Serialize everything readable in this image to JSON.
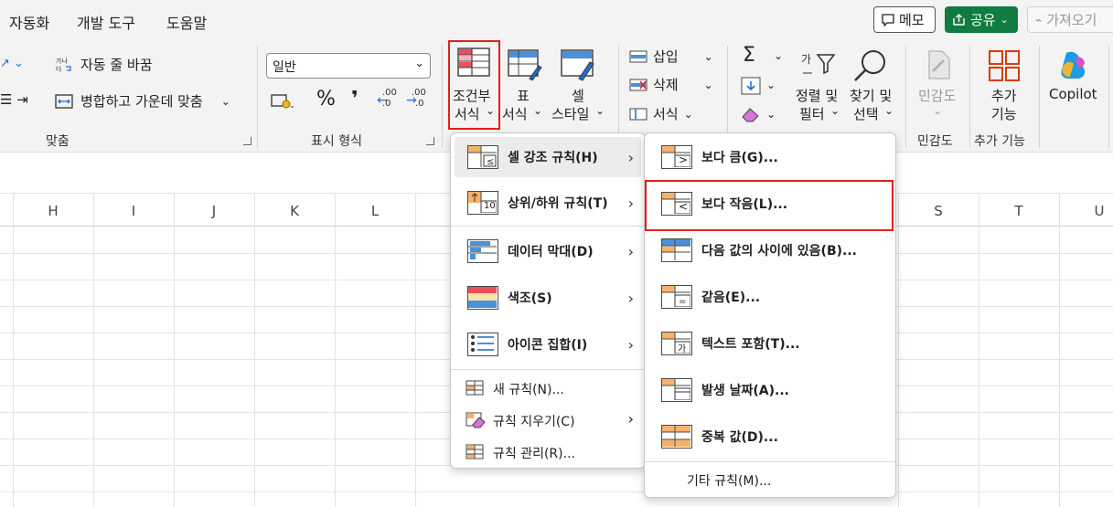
{
  "menubar": {
    "tabs": [
      "자동화",
      "개발 도구",
      "도움말"
    ],
    "memo_label": "메모",
    "share_label": "공유",
    "import_label": "가져오기"
  },
  "ribbon": {
    "alignment": {
      "wrap_text": "자동 줄 바꿈",
      "merge_center": "병합하고 가운데 맞춤",
      "group_label": "맞춤"
    },
    "number": {
      "format_value": "일반",
      "group_label": "표시 형식",
      "percent_symbol": "%",
      "comma_symbol": "❜",
      "inc_decimal": ".00",
      "dec_decimal": ".00"
    },
    "styles": {
      "conditional_line1": "조건부",
      "conditional_line2": "서식",
      "table_line1": "표",
      "table_line2": "서식",
      "cell_line1": "셀",
      "cell_line2": "스타일"
    },
    "cells": {
      "insert": "삽입",
      "delete": "삭제",
      "format": "서식"
    },
    "editing": {
      "sort_line1": "정렬 및",
      "sort_line2": "필터",
      "find_line1": "찾기 및",
      "find_line2": "선택"
    },
    "sensitivity": {
      "line1": "민감도",
      "group_label": "민감도"
    },
    "addins": {
      "line1": "추가",
      "line2": "기능",
      "group_label": "추가 기능"
    },
    "copilot": {
      "label": "Copilot"
    }
  },
  "sheet": {
    "columns": [
      "H",
      "I",
      "J",
      "K",
      "L",
      "S",
      "T",
      "U"
    ]
  },
  "cf_menu": {
    "items": [
      {
        "label": "셀 강조 규칙(H)"
      },
      {
        "label": "상위/하위 규칙(T)"
      },
      {
        "label": "데이터 막대(D)"
      },
      {
        "label": "색조(S)"
      },
      {
        "label": "아이콘 집합(I)"
      }
    ],
    "small_items": [
      {
        "label": "새 규칙(N)..."
      },
      {
        "label": "규칙 지우기(C)"
      },
      {
        "label": "규칙 관리(R)..."
      }
    ],
    "top10_badge": "10"
  },
  "highlight_menu": {
    "items": [
      {
        "label": "보다 큼(G)..."
      },
      {
        "label": "보다 작음(L)..."
      },
      {
        "label": "다음 값의 사이에 있음(B)..."
      },
      {
        "label": "같음(E)..."
      },
      {
        "label": "텍스트 포함(T)..."
      },
      {
        "label": "발생 날짜(A)..."
      },
      {
        "label": "중복 값(D)..."
      }
    ],
    "more_rules": "기타 규칙(M)...",
    "icon_glyphs": [
      ">",
      "<",
      "",
      "=",
      "가",
      "",
      ""
    ]
  },
  "colors": {
    "accent_green": "#107c41",
    "highlight_red": "#e0201a",
    "cell_orange": "#f6b26b",
    "cell_blue": "#4a90d9"
  }
}
